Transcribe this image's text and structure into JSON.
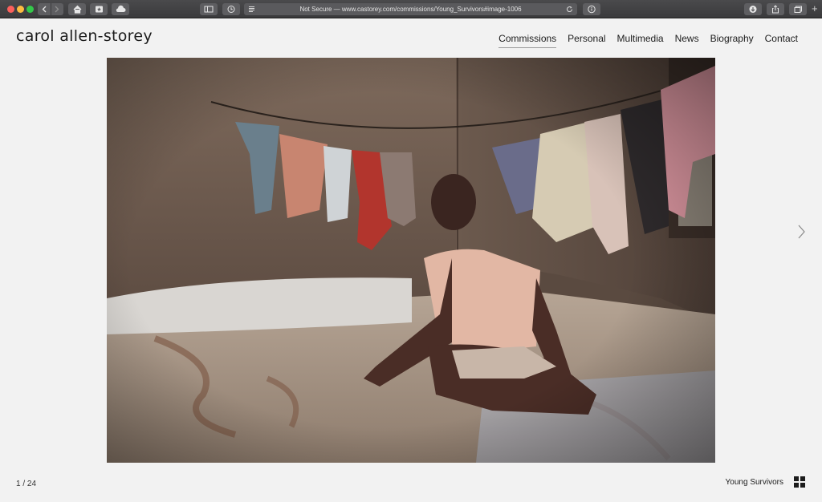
{
  "browser": {
    "url_prefix": "Not Secure — ",
    "url": "www.castorey.com/commissions/Young_Survivors#image-1006",
    "new_tab_label": "+"
  },
  "site": {
    "logo": "carol allen-storey",
    "nav": [
      {
        "label": "Commissions",
        "active": true
      },
      {
        "label": "Personal"
      },
      {
        "label": "Multimedia"
      },
      {
        "label": "News"
      },
      {
        "label": "Biography"
      },
      {
        "label": "Contact"
      }
    ]
  },
  "gallery": {
    "counter": "1 / 24",
    "title": "Young Survivors"
  },
  "colors": {
    "page_bg": "#f2f2f2",
    "text": "#1c1c1c",
    "chrome": "#3a3a3c"
  },
  "icons": [
    "back-icon",
    "forward-icon",
    "home-icon",
    "star-icon",
    "cloud-icon",
    "sidebar-icon",
    "history-icon",
    "reader-icon",
    "reload-icon",
    "info-icon",
    "download-icon",
    "share-icon",
    "tabs-icon",
    "chevron-right-icon",
    "grid-icon"
  ]
}
